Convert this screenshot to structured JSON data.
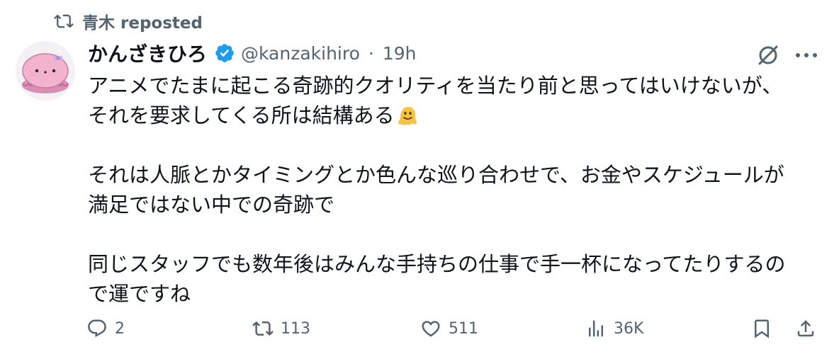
{
  "repost": {
    "icon": "repost-icon",
    "text": "青木 reposted"
  },
  "author": {
    "display_name": "かんざきひろ",
    "handle": "@kanzakihiro",
    "separator": "·",
    "time": "19h",
    "verified": true,
    "verified_color": "#1d9bf0",
    "avatar": "avatar-pink-character"
  },
  "tweet": {
    "paragraphs": [
      [
        "アニメでたまに起こる奇跡的クオリティを当たり前と思ってはいけないが、",
        "それを要求してくる所は結構ある"
      ],
      [
        "それは人脈とかタイミングとか色んな巡り合わせで、お金やスケジュールが",
        "満足ではない中での奇跡で"
      ],
      [
        "同じスタッフでも数年後はみんな手持ちの仕事で手一杯になってたりするの",
        "で運ですね"
      ]
    ],
    "emoji": "melting-face-emoji"
  },
  "actions": {
    "reply_count": "2",
    "repost_count": "113",
    "like_count": "511",
    "views_count": "36K"
  },
  "colors": {
    "text": "#0f1419",
    "secondary": "#536471",
    "accent": "#1d9bf0"
  }
}
